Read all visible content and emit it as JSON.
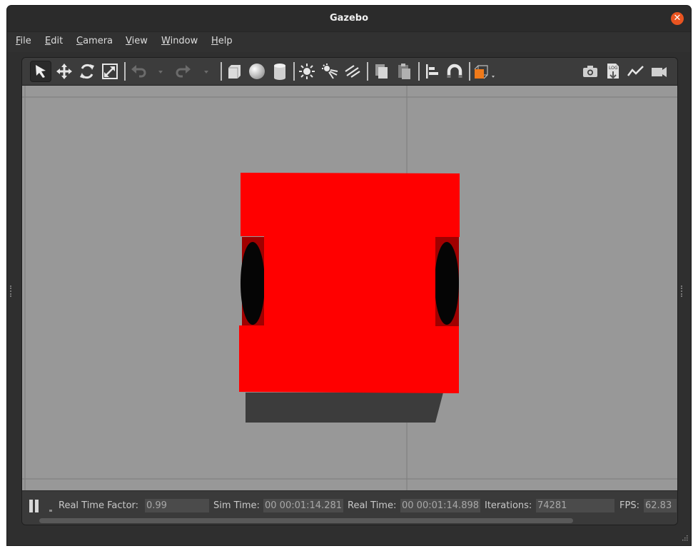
{
  "window": {
    "title": "Gazebo"
  },
  "menu": [
    "File",
    "Edit",
    "Camera",
    "View",
    "Window",
    "Help"
  ],
  "toolbar": {
    "tools": [
      {
        "name": "select-mode",
        "icon": "arrow-pointer-icon"
      },
      {
        "name": "translate-mode",
        "icon": "move-arrows-icon"
      },
      {
        "name": "rotate-mode",
        "icon": "rotate-icon"
      },
      {
        "name": "scale-mode",
        "icon": "scale-icon"
      },
      {
        "name": "undo",
        "icon": "undo-icon"
      },
      {
        "name": "redo",
        "icon": "redo-icon"
      },
      {
        "name": "box-shape",
        "icon": "box-icon"
      },
      {
        "name": "sphere-shape",
        "icon": "sphere-icon"
      },
      {
        "name": "cylinder-shape",
        "icon": "cylinder-icon"
      },
      {
        "name": "point-light",
        "icon": "sun-icon"
      },
      {
        "name": "spot-light",
        "icon": "spotlight-icon"
      },
      {
        "name": "directional-light",
        "icon": "directional-light-icon"
      },
      {
        "name": "copy",
        "icon": "copy-icon"
      },
      {
        "name": "paste",
        "icon": "paste-icon"
      },
      {
        "name": "align",
        "icon": "align-icon"
      },
      {
        "name": "snap",
        "icon": "magnet-icon"
      },
      {
        "name": "view-angle",
        "icon": "orange-cube-icon"
      },
      {
        "name": "screenshot",
        "icon": "camera-icon"
      },
      {
        "name": "log",
        "icon": "log-icon"
      },
      {
        "name": "plot",
        "icon": "plot-icon"
      },
      {
        "name": "record-video",
        "icon": "video-camera-icon"
      }
    ],
    "log_icon_text": "LOG"
  },
  "status": {
    "real_time_factor_label": "Real Time Factor:",
    "real_time_factor": "0.99",
    "sim_time_label": "Sim Time:",
    "sim_time": "00 00:01:14.281",
    "real_time_label": "Real Time:",
    "real_time": "00 00:01:14.898",
    "iterations_label": "Iterations:",
    "iterations": "74281",
    "fps_label": "FPS:",
    "fps": "62.83"
  },
  "colors": {
    "robot_body": "#ff0000",
    "wheels": "#000000",
    "ground": "#989898",
    "shadow": "#3c3c3c",
    "close_button": "#e95420",
    "view_angle_icon": "#f07a1a"
  }
}
